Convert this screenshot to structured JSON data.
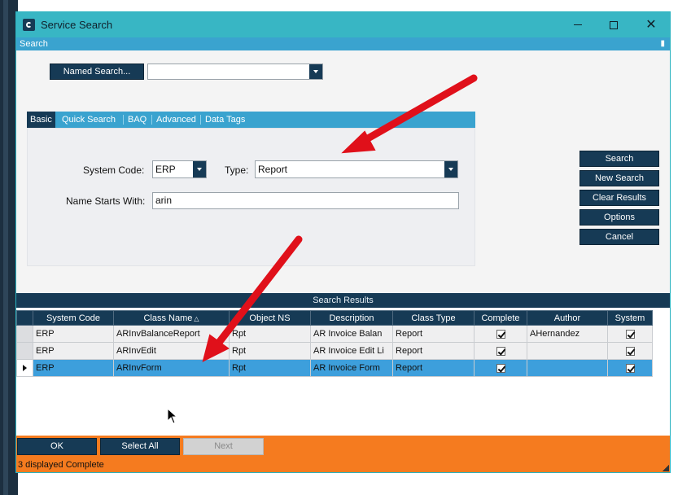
{
  "window": {
    "title": "Service Search",
    "controls": {
      "minimize": "—",
      "maximize": "",
      "close": "✕"
    }
  },
  "search_panel": {
    "header": "Search",
    "named_search_label": "Named Search...",
    "named_search_value": "",
    "tabs": [
      {
        "label": "Basic",
        "active": true
      },
      {
        "label": "Quick Search",
        "active": false
      },
      {
        "label": "BAQ",
        "active": false
      },
      {
        "label": "Advanced",
        "active": false
      },
      {
        "label": "Data Tags",
        "active": false
      }
    ],
    "fields": {
      "system_code_label": "System Code:",
      "system_code_value": "ERP",
      "type_label": "Type:",
      "type_value": "Report",
      "name_starts_label": "Name Starts With:",
      "name_starts_value": "arin"
    },
    "side_buttons": {
      "search": "Search",
      "new_search": "New Search",
      "clear_results": "Clear Results",
      "options": "Options",
      "cancel": "Cancel"
    }
  },
  "results": {
    "header": "Search Results",
    "columns": [
      "System Code",
      "Class Name",
      "Object NS",
      "Description",
      "Class Type",
      "Complete",
      "Author",
      "System"
    ],
    "sorted_column": "Class Name",
    "rows": [
      {
        "system_code": "ERP",
        "class_name": "ARInvBalanceReport",
        "object_ns": "Rpt",
        "description": "AR Invoice Balan",
        "class_type": "Report",
        "complete": true,
        "author": "AHernandez",
        "system": true,
        "selected": false
      },
      {
        "system_code": "ERP",
        "class_name": "ARInvEdit",
        "object_ns": "Rpt",
        "description": "AR Invoice Edit Li",
        "class_type": "Report",
        "complete": true,
        "author": "",
        "system": true,
        "selected": false
      },
      {
        "system_code": "ERP",
        "class_name": "ARInvForm",
        "object_ns": "Rpt",
        "description": "AR Invoice Form",
        "class_type": "Report",
        "complete": true,
        "author": "",
        "system": true,
        "selected": true
      }
    ]
  },
  "footer": {
    "ok": "OK",
    "select_all": "Select All",
    "next": "Next",
    "status": "3 displayed Complete"
  },
  "colors": {
    "title_bar": "#38b6c4",
    "panel_header": "#3aa3cf",
    "dark_button": "#163a55",
    "selected_row": "#3d9fdc",
    "footer": "#f57b1f",
    "annotation_arrow": "#e0101a"
  }
}
